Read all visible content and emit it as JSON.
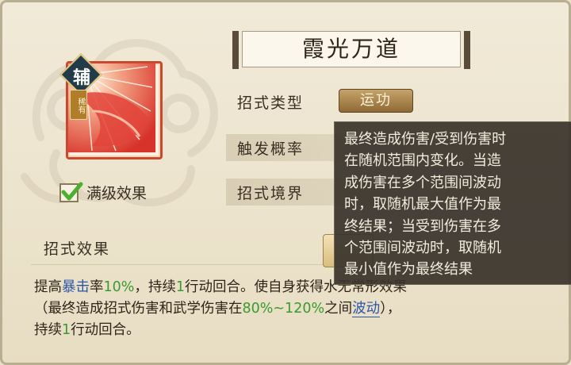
{
  "skill": {
    "name": "霞光万道",
    "type_badge": "辅",
    "rarity": "稀有",
    "max_level_label": "满级效果",
    "max_level_checked": true
  },
  "stats": {
    "move_type_label": "招式类型",
    "move_type_value": "运功",
    "trigger_label": "触发概率",
    "realm_label": "招式境界"
  },
  "effect": {
    "header": "招式效果",
    "desc": {
      "l1_a": "提高",
      "l1_kw": "暴击",
      "l1_b": "率",
      "l1_num": "10%",
      "l1_c": "，持续",
      "l1_n2": "1",
      "l1_d": "行动回合。使自身获得水无常形效果",
      "l2_a": "（最终造成招式伤害和武学伤害在",
      "l2_range": "80%~120%",
      "l2_b": "之间",
      "l2_link": "波动",
      "l2_c": "），",
      "l3_a": "持续",
      "l3_n": "1",
      "l3_b": "行动回合。"
    }
  },
  "tooltip": {
    "lines": [
      "最终造成伤害/受到伤害时",
      "在随机范围内变化。当造",
      "成伤害在多个范围间波动",
      "时，取随机最大值作为最",
      "终结果；当受到伤害在多",
      "个范围间波动时，取随机",
      "最小值作为最终结果"
    ]
  },
  "colors": {
    "keyword_blue": "#2b55a8",
    "number_green": "#3a9a2e",
    "card_red": "#e0503a"
  }
}
